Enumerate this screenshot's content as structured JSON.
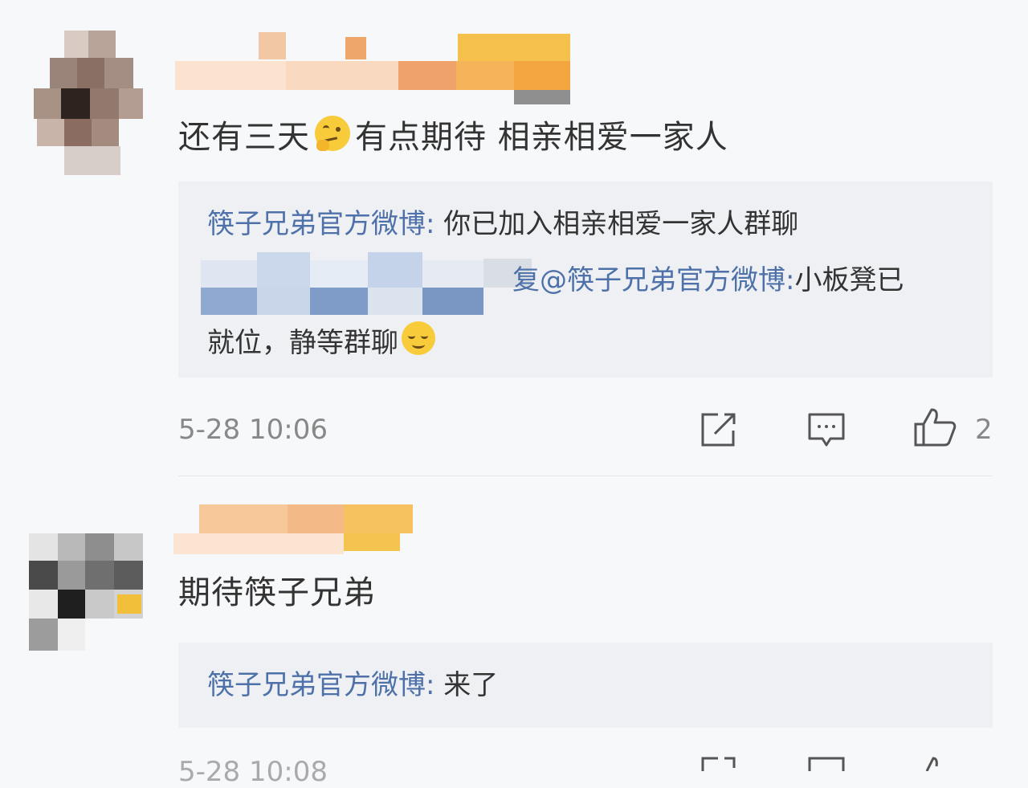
{
  "comments": [
    {
      "text_before_emoji": "还有三天",
      "emoji": "thinking-face-icon",
      "text_after_emoji": "有点期待 相亲相爱一家人",
      "replies": [
        {
          "author": "筷子兄弟官方微博",
          "separator": ": ",
          "text": "你已加入相亲相爱一家人群聊"
        },
        {
          "reply_word": "复",
          "mention": "@筷子兄弟官方微博",
          "separator": ":",
          "text_line1": "小板凳已",
          "text_line2": "就位，静等群聊",
          "emoji": "relieved-face-icon"
        }
      ],
      "timestamp": "5-28 10:06",
      "like_count": "2"
    },
    {
      "text": "期待筷子兄弟",
      "replies": [
        {
          "author": "筷子兄弟官方微博",
          "separator": ": ",
          "text": "来了"
        }
      ],
      "timestamp": "5-28 10:08"
    }
  ],
  "actions": {
    "share_icon": "share-icon",
    "comment_icon": "comment-icon",
    "like_icon": "thumbs-up-icon"
  }
}
